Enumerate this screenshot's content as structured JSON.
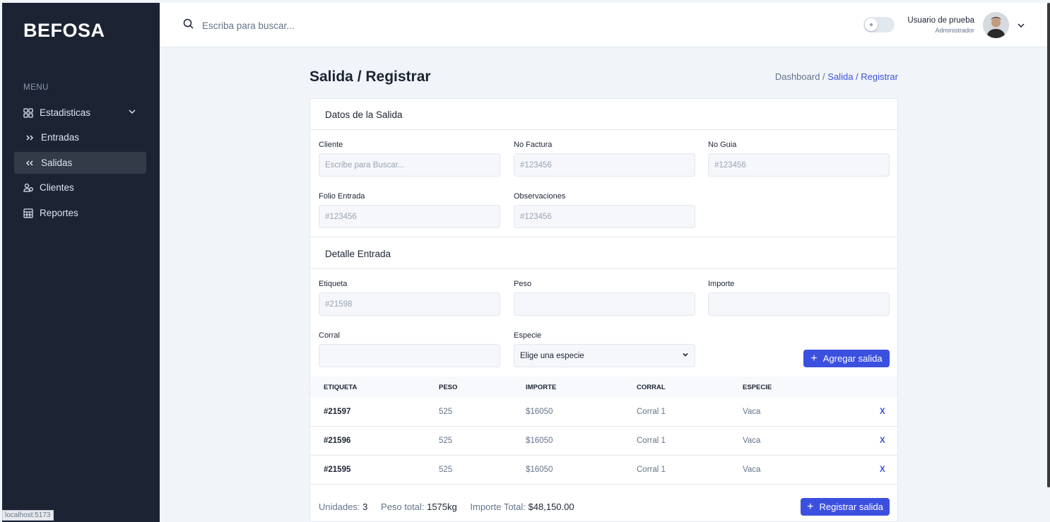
{
  "sidebar": {
    "brand": "BEFOSA",
    "menu_label": "MENU",
    "items": [
      {
        "label": "Estadisticas",
        "icon": "grid-icon"
      },
      {
        "label": "Entradas",
        "icon": "double-chevron-right-icon"
      },
      {
        "label": "Salidas",
        "icon": "double-chevron-left-icon",
        "active": true
      },
      {
        "label": "Clientes",
        "icon": "users-icon"
      },
      {
        "label": "Reportes",
        "icon": "table-icon"
      }
    ]
  },
  "status_url": "localhost:5173",
  "header": {
    "search_placeholder": "Escriba para buscar...",
    "user_name": "Usuario de prueba",
    "user_role": "Administrador"
  },
  "page": {
    "title": "Salida / Registrar",
    "breadcrumb_root": "Dashboard /",
    "breadcrumb_current": "Salida / Registrar"
  },
  "datos": {
    "title": "Datos de la Salida",
    "fields": [
      {
        "label": "Cliente",
        "placeholder": "Escribe para Buscar..."
      },
      {
        "label": "No Factura",
        "placeholder": "#123456"
      },
      {
        "label": "No Guia",
        "placeholder": "#123456"
      },
      {
        "label": "Folio Entrada",
        "placeholder": "#123456"
      },
      {
        "label": "Observaciones",
        "placeholder": "#123456"
      }
    ]
  },
  "detalle": {
    "title": "Detalle Entrada",
    "fields": [
      {
        "label": "Etiqueta",
        "placeholder": "#21598"
      },
      {
        "label": "Peso",
        "placeholder": ""
      },
      {
        "label": "Importe",
        "placeholder": ""
      },
      {
        "label": "Corral",
        "placeholder": ""
      },
      {
        "label": "Especie",
        "value": "Elige una especie"
      }
    ],
    "add_button": "Agregar salida"
  },
  "table": {
    "headers": [
      "ETIQUETA",
      "PESO",
      "IMPORTE",
      "CORRAL",
      "ESPECIE"
    ],
    "rows": [
      {
        "etiqueta": "#21597",
        "peso": "525",
        "importe": "$16050",
        "corral": "Corral 1",
        "especie": "Vaca",
        "delete": "X"
      },
      {
        "etiqueta": "#21596",
        "peso": "525",
        "importe": "$16050",
        "corral": "Corral 1",
        "especie": "Vaca",
        "delete": "X"
      },
      {
        "etiqueta": "#21595",
        "peso": "525",
        "importe": "$16050",
        "corral": "Corral 1",
        "especie": "Vaca",
        "delete": "X"
      }
    ]
  },
  "summary": {
    "unidades_label": "Unidades:",
    "unidades_value": "3",
    "peso_label": "Peso total:",
    "peso_value": "1575kg",
    "importe_label": "Importe Total:",
    "importe_value": "$48,150.00",
    "register_button": "Registrar salida"
  },
  "colors": {
    "sidebar_bg": "#1c2434",
    "accent": "#3c50e0",
    "page_bg": "#f1f5f9"
  }
}
